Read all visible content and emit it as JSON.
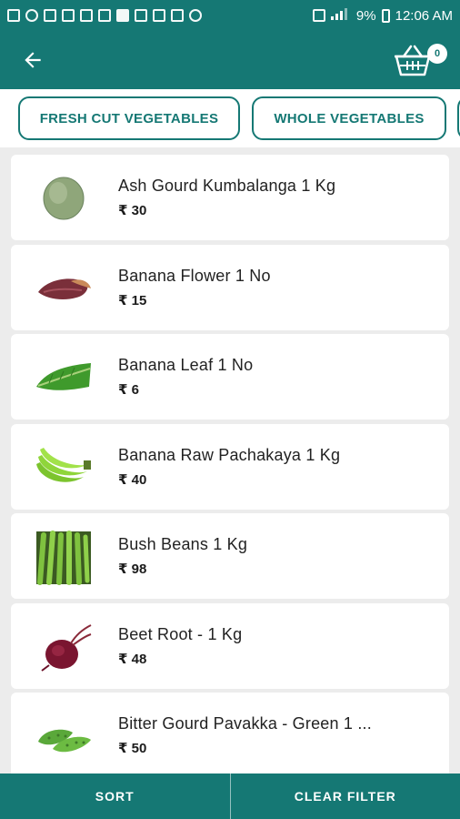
{
  "status_bar": {
    "battery": "9%",
    "time": "12:06 AM"
  },
  "header": {
    "back_icon": "arrow-left-icon",
    "cart_icon": "basket-icon",
    "cart_count": "0"
  },
  "filters": {
    "chips": [
      "FRESH CUT VEGETABLES",
      "WHOLE VEGETABLES",
      ""
    ]
  },
  "products": [
    {
      "name": "Ash Gourd  Kumbalanga  1 Kg",
      "price": "₹ 30",
      "image": "ash-gourd"
    },
    {
      "name": "Banana Flower 1 No",
      "price": "₹ 15",
      "image": "banana-flower"
    },
    {
      "name": "Banana Leaf 1 No",
      "price": "₹ 6",
      "image": "banana-leaf"
    },
    {
      "name": "Banana Raw  Pachakaya  1 Kg",
      "price": "₹ 40",
      "image": "raw-banana"
    },
    {
      "name": "Bush Beans 1 Kg",
      "price": "₹ 98",
      "image": "bush-beans"
    },
    {
      "name": "Beet Root - 1 Kg",
      "price": "₹ 48",
      "image": "beet-root"
    },
    {
      "name": "Bitter Gourd  Pavakka  - Green 1 ...",
      "price": "₹ 50",
      "image": "bitter-gourd"
    }
  ],
  "bottom_bar": {
    "sort_label": "SORT",
    "clear_label": "CLEAR FILTER"
  },
  "colors": {
    "primary": "#157874",
    "background": "#ececec"
  }
}
